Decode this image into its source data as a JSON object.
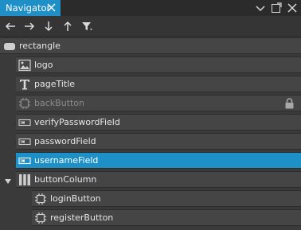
{
  "panel": {
    "title": "Navigator"
  },
  "tree": {
    "root": {
      "label": "rectangle"
    },
    "items": [
      {
        "label": "logo"
      },
      {
        "label": "pageTitle"
      },
      {
        "label": "backButton"
      },
      {
        "label": "verifyPasswordField"
      },
      {
        "label": "passwordField"
      },
      {
        "label": "usernameField"
      },
      {
        "label": "buttonColumn"
      }
    ],
    "children": [
      {
        "label": "loginButton"
      },
      {
        "label": "registerButton"
      }
    ]
  },
  "colors": {
    "accent": "#1e90c8",
    "row_bg": "#454545",
    "panel_bg": "#3a3a3a"
  }
}
